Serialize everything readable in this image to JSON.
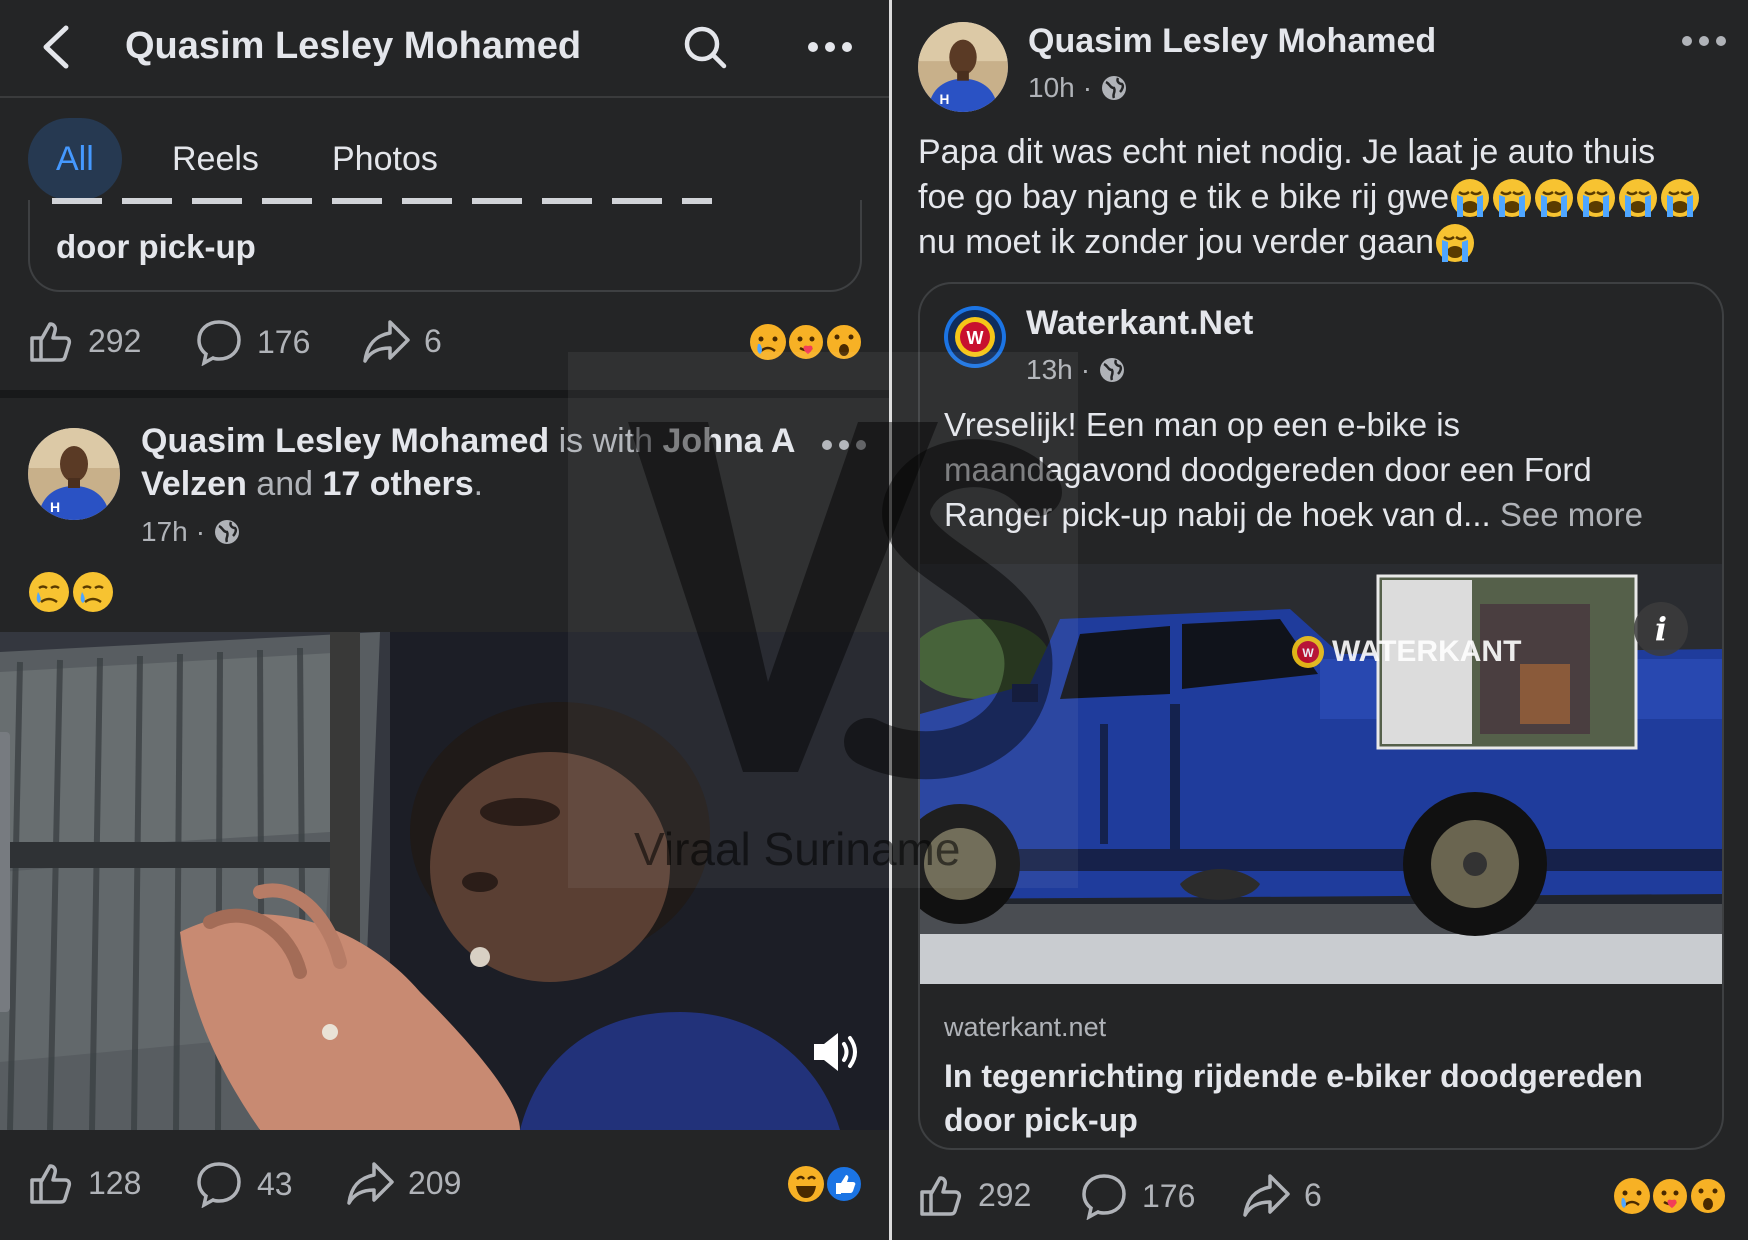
{
  "left": {
    "header": {
      "title": "Quasim Lesley Mohamed"
    },
    "tabs": [
      {
        "label": "All"
      },
      {
        "label": "Reels"
      },
      {
        "label": "Photos"
      }
    ],
    "prev_post": {
      "link_title_tail": "door pick-up",
      "likes": "292",
      "comments": "176",
      "shares": "6"
    },
    "post": {
      "author": "Quasim Lesley Mohamed",
      "with_text": "is with",
      "tagged": "Johna A Velzen",
      "and_text": "and",
      "others": "17 others",
      "period": ".",
      "time": "17h",
      "likes": "128",
      "comments": "43",
      "shares": "209"
    }
  },
  "right": {
    "post": {
      "author": "Quasim Lesley Mohamed",
      "time": "10h",
      "text_line1": "Papa dit was echt niet nodig. Je laat je auto thuis",
      "text_line2": "foe go bay njang e tik e bike rij gwe",
      "text_line3": "nu moet ik zonder jou verder gaan",
      "likes": "292",
      "comments": "176",
      "shares": "6"
    },
    "shared": {
      "page_name": "Waterkant.Net",
      "time": "13h",
      "text_line1": "Vreselijk! Een man op een e-bike is",
      "text_line2": "maandagavond doodgereden door een Ford",
      "text_line3": "Ranger pick-up nabij de hoek van d...",
      "see_more": "See more",
      "watermark": "WATERKANT",
      "domain": "waterkant.net",
      "link_title_line1": "In tegenrichting rijdende e-biker doodgereden",
      "link_title_line2": "door pick-up"
    }
  },
  "overlay": {
    "watermark_text": "Viraal Suriname"
  },
  "colors": {
    "background": "#242526",
    "active_tab": "#4599ff",
    "active_tab_bg": "#263951",
    "car": "#1f3c9c"
  }
}
